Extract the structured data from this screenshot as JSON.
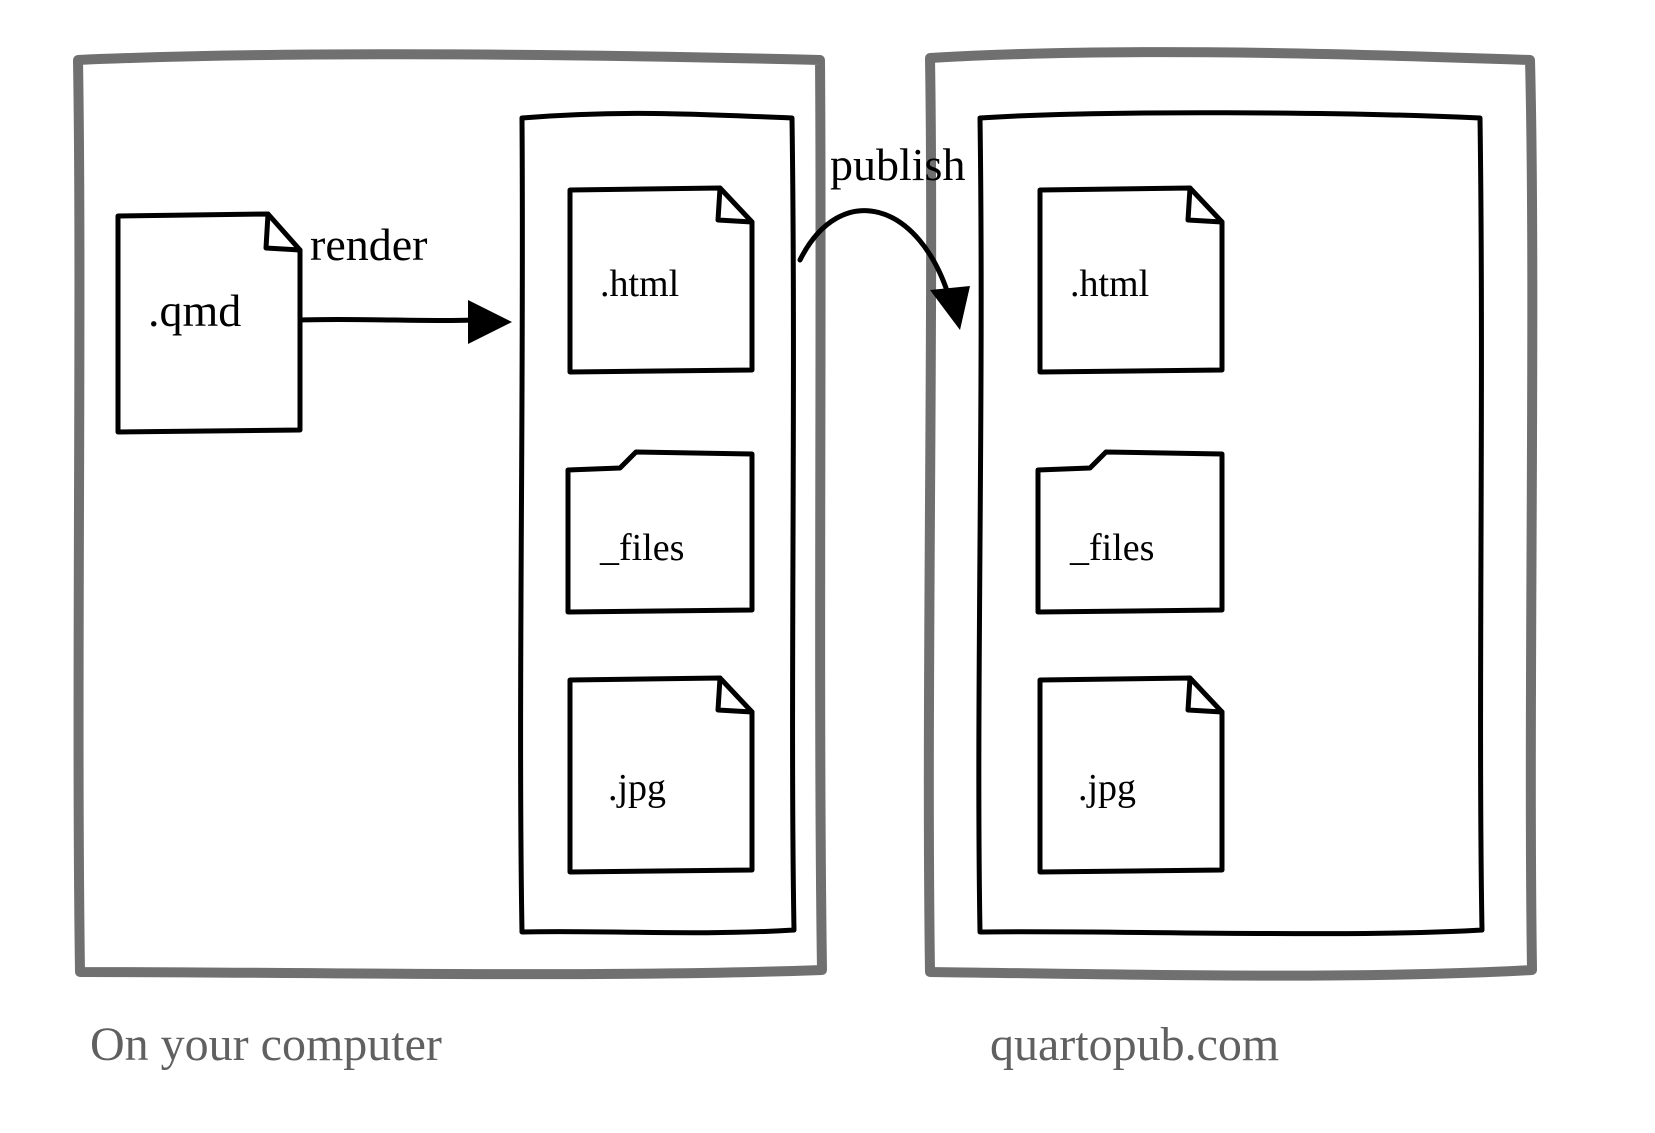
{
  "source_file_ext": ".qmd",
  "actions": {
    "render": "render",
    "publish": "publish"
  },
  "outputs": {
    "html": ".html",
    "files_dir": "_files",
    "jpg": ".jpg"
  },
  "captions": {
    "local": "On your computer",
    "remote": "quartopub.com"
  }
}
